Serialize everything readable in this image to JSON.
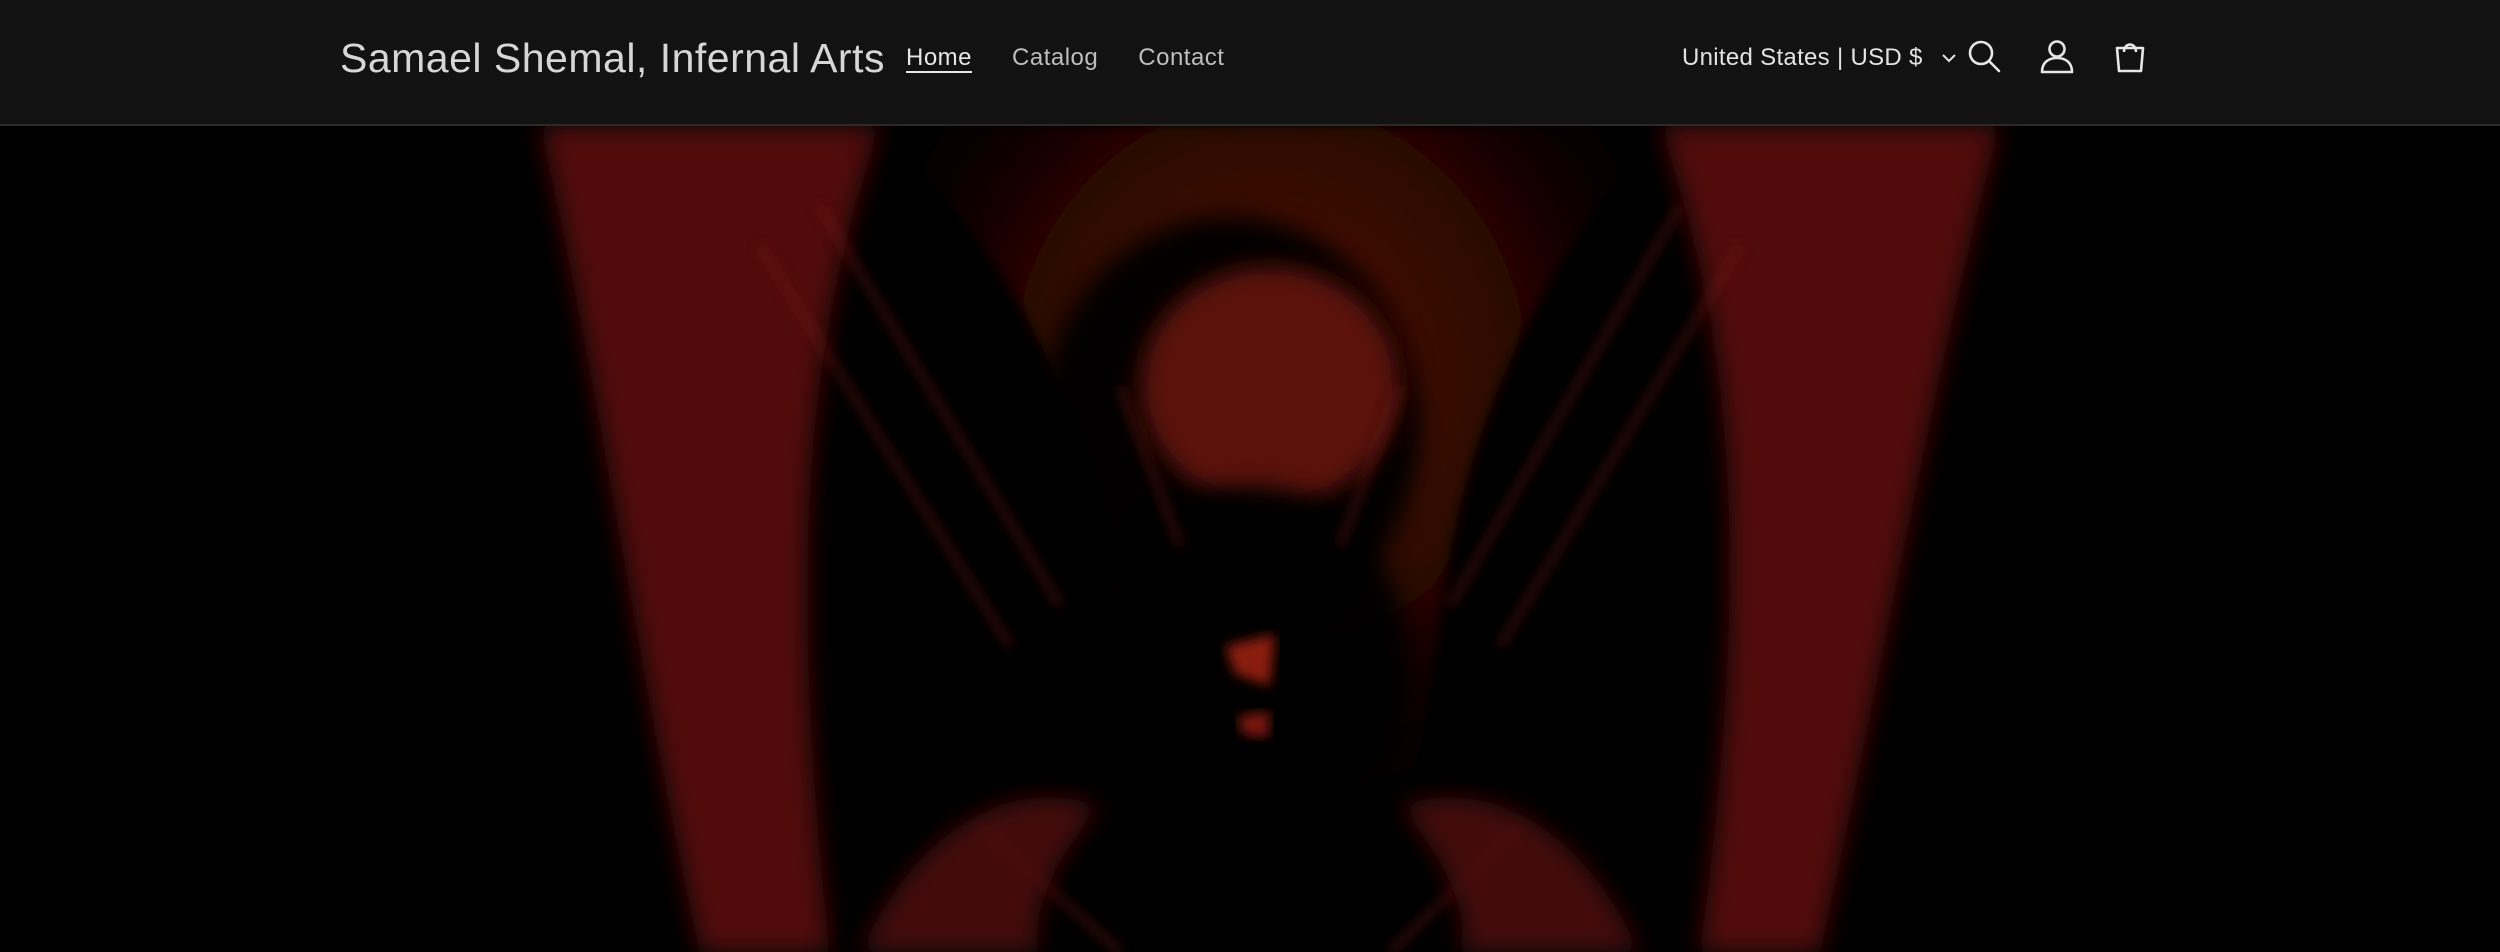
{
  "header": {
    "brand": "Samael Shemal, Infernal Arts",
    "nav": [
      {
        "label": "Home",
        "active": true
      },
      {
        "label": "Catalog",
        "active": false
      },
      {
        "label": "Contact",
        "active": false
      }
    ],
    "locale": "United States | USD $",
    "icons": [
      "chevron-down-icon",
      "search-icon",
      "account-icon",
      "cart-icon"
    ]
  },
  "colors": {
    "header_bg": "#121212",
    "hero_bg": "#000000",
    "hero_accent": "#7a1a12"
  }
}
